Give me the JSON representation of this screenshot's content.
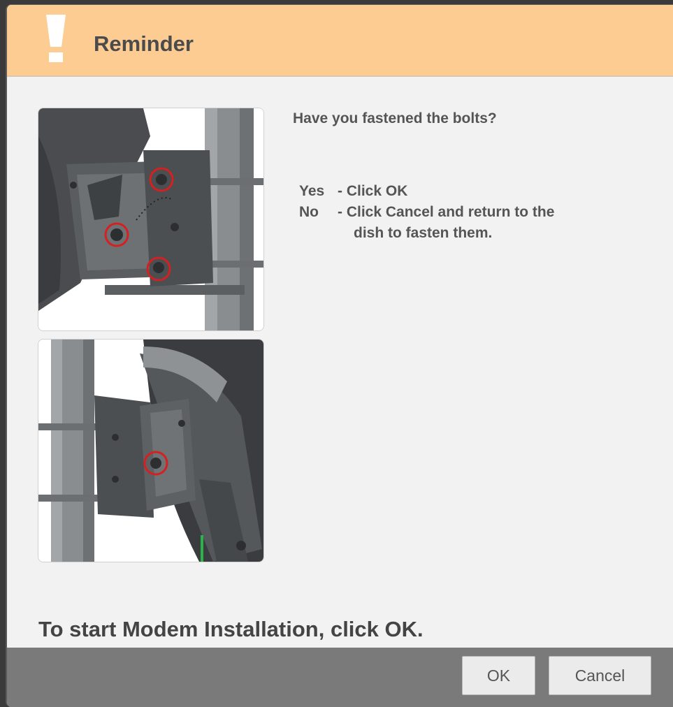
{
  "dialog": {
    "title": "Reminder",
    "title_icon": "exclamation-warning-icon",
    "question": "Have you fastened the bolts?",
    "answers": [
      {
        "key": "Yes",
        "text": "- Click OK"
      },
      {
        "key": "No",
        "text": "- Click Cancel and return to the",
        "continuation": "dish to fasten them."
      }
    ],
    "images": [
      {
        "name": "dish-mount-bolts-front-image",
        "highlighted_bolts": 3
      },
      {
        "name": "dish-mount-bolts-rear-image",
        "highlighted_bolts": 1
      }
    ],
    "start_instruction": "To start Modem Installation, click OK.",
    "buttons": {
      "ok": "OK",
      "cancel": "Cancel"
    }
  },
  "colors": {
    "titlebar": "#fdcc93",
    "body_bg": "#f2f2f2",
    "footer_bg": "#7a7a7a",
    "highlight_circle": "#d42020"
  }
}
